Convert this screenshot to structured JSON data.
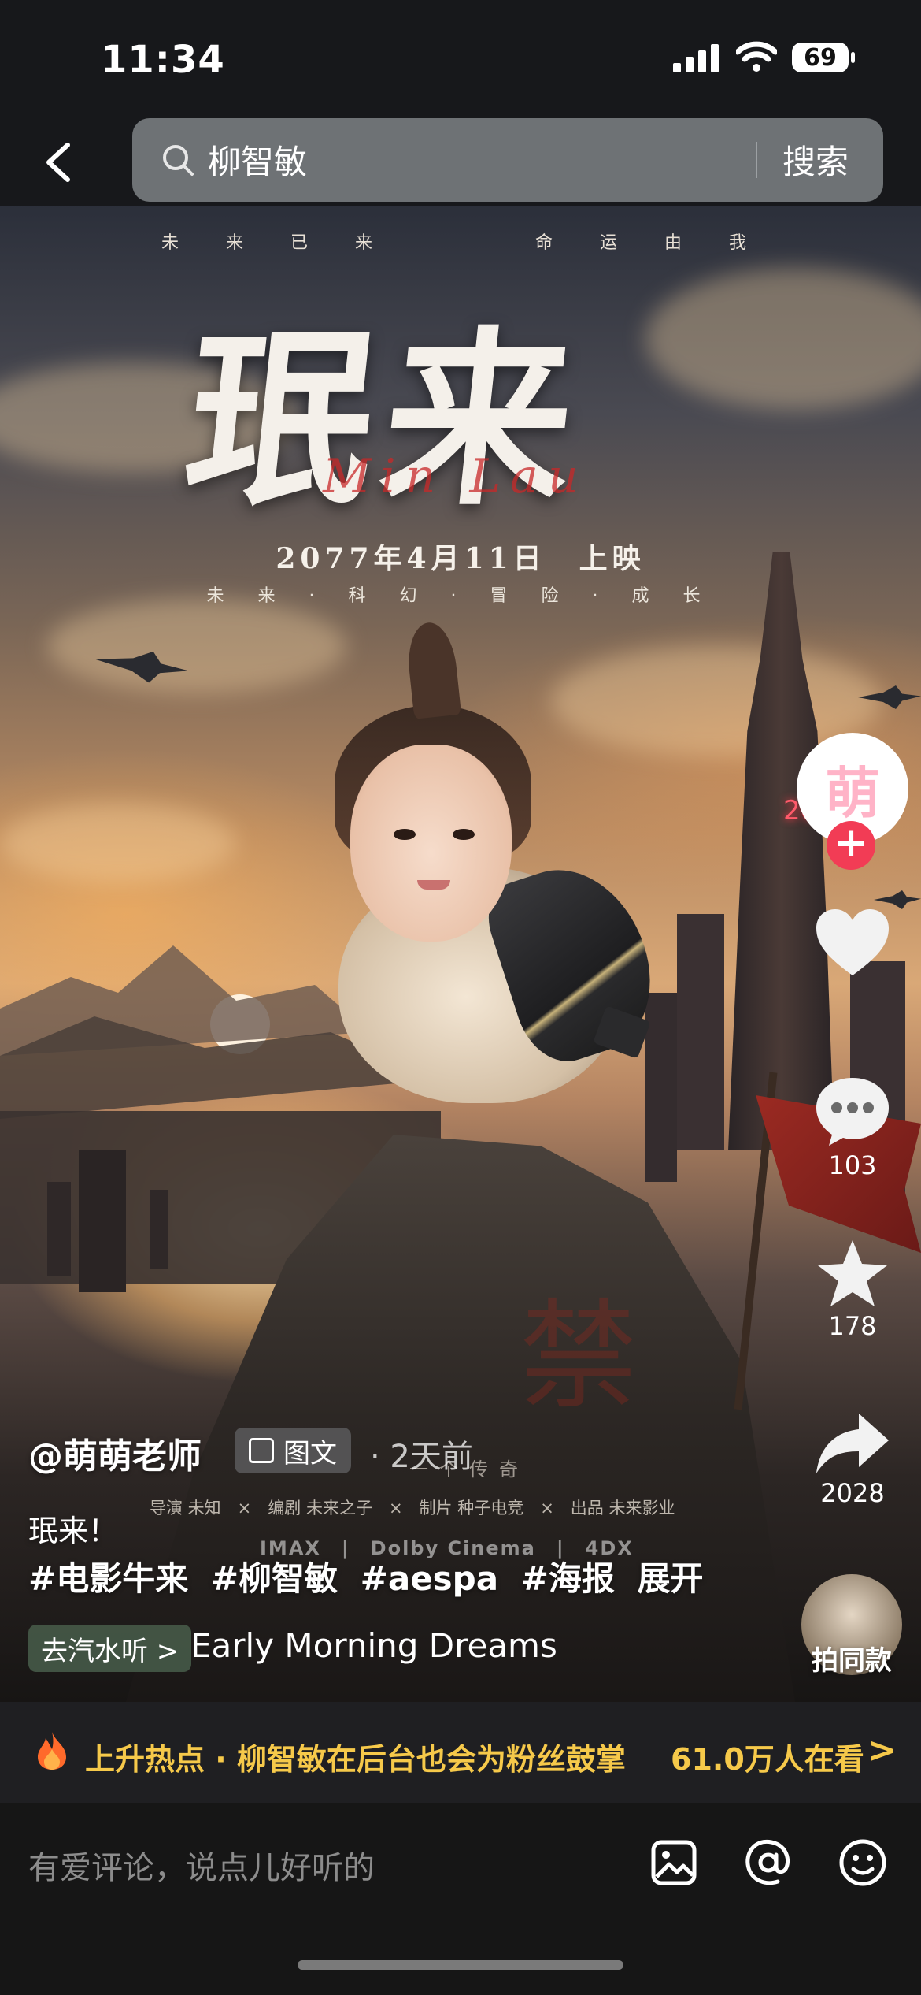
{
  "status_bar": {
    "time": "11:34",
    "battery": "69"
  },
  "search": {
    "query": "柳智敏",
    "button": "搜索"
  },
  "poster": {
    "tagline_left": "未来已来",
    "tagline_right": "命运由我",
    "title": "珉来",
    "signature": "Min Lau",
    "date": "2077年4月11日　上映",
    "genre": "未 来 · 科 幻 · 冒 险 · 成 长",
    "legend": "一个传奇",
    "credits": "导演  未知　×　编剧  未来之子　×　制片  种子电竞　×　出品  未来影业",
    "formats": "IMAX　|　Dolby Cinema　|　4DX",
    "neon_sign": "2077"
  },
  "actions": {
    "avatar_char": "萌",
    "follow": "+",
    "like_count": "",
    "comment_count": "103",
    "favorite_count": "178",
    "share_count": "2028",
    "make_same": "拍同款"
  },
  "post": {
    "author": "@萌萌老师",
    "type_badge": "图文",
    "posted": "· 2天前",
    "caption": "珉来！",
    "tags": [
      "#电影牛来",
      "#柳智敏",
      "#aespa",
      "#海报"
    ],
    "expand": "展开",
    "music_button": "去汽水听 >",
    "music_title": "Early Morning Dreams"
  },
  "hot_banner": {
    "text": "上升热点 · 柳智敏在后台也会为粉丝鼓掌",
    "watching": "61.0万人在看",
    "chevron": ">"
  },
  "comment_bar": {
    "placeholder": "有爱评论，说点儿好听的"
  }
}
